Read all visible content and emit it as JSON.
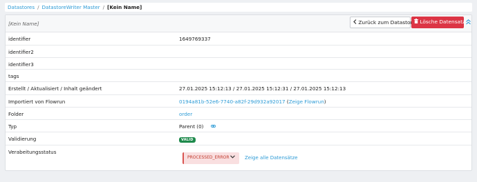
{
  "breadcrumb": {
    "items": [
      "Datastores",
      "DatastoreWriter Master"
    ],
    "separator": "/",
    "current": "[Kein Name]"
  },
  "header": {
    "title": "[Kein Name]",
    "back_label": "Zurück zum Datastore",
    "delete_label": "Lösche Datensatz"
  },
  "rows": [
    {
      "label": "identifier",
      "value": "1649769337"
    },
    {
      "label": "identifier2",
      "value": ""
    },
    {
      "label": "identifier3",
      "value": ""
    },
    {
      "label": "tags",
      "value": ""
    },
    {
      "label": "Erstellt / Aktualisiert / Inhalt geändert",
      "value": "27.01.2025 15:12:13 / 27.01.2025 15:12:31 / 27.01.2025 15:12:13"
    },
    {
      "label": "Importiert von Flowrun",
      "link": "0194a81b-52e6-7740-a82f-29d932a92017",
      "link2": "Zeige Flowrun"
    },
    {
      "label": "Folder",
      "link": "order"
    },
    {
      "label": "Typ",
      "value": "Parent (0)"
    },
    {
      "label": "Validierung",
      "badge": "VALID"
    },
    {
      "label": "Verabeitungsstatus",
      "status": "PROCESSED_ERROR",
      "show_all": "Zeige alle Datensätze"
    }
  ],
  "colors": {
    "accent": "#2d9bd6",
    "danger": "#dc3545",
    "success": "#1e8a4c",
    "error_bg": "#f9dfe0"
  },
  "icons": {
    "back": "chevron-left-icon",
    "delete": "trash-icon",
    "collapse": "double-chevron-up-icon",
    "type_link": "link-icon",
    "status_dropdown": "chevron-down-icon"
  }
}
